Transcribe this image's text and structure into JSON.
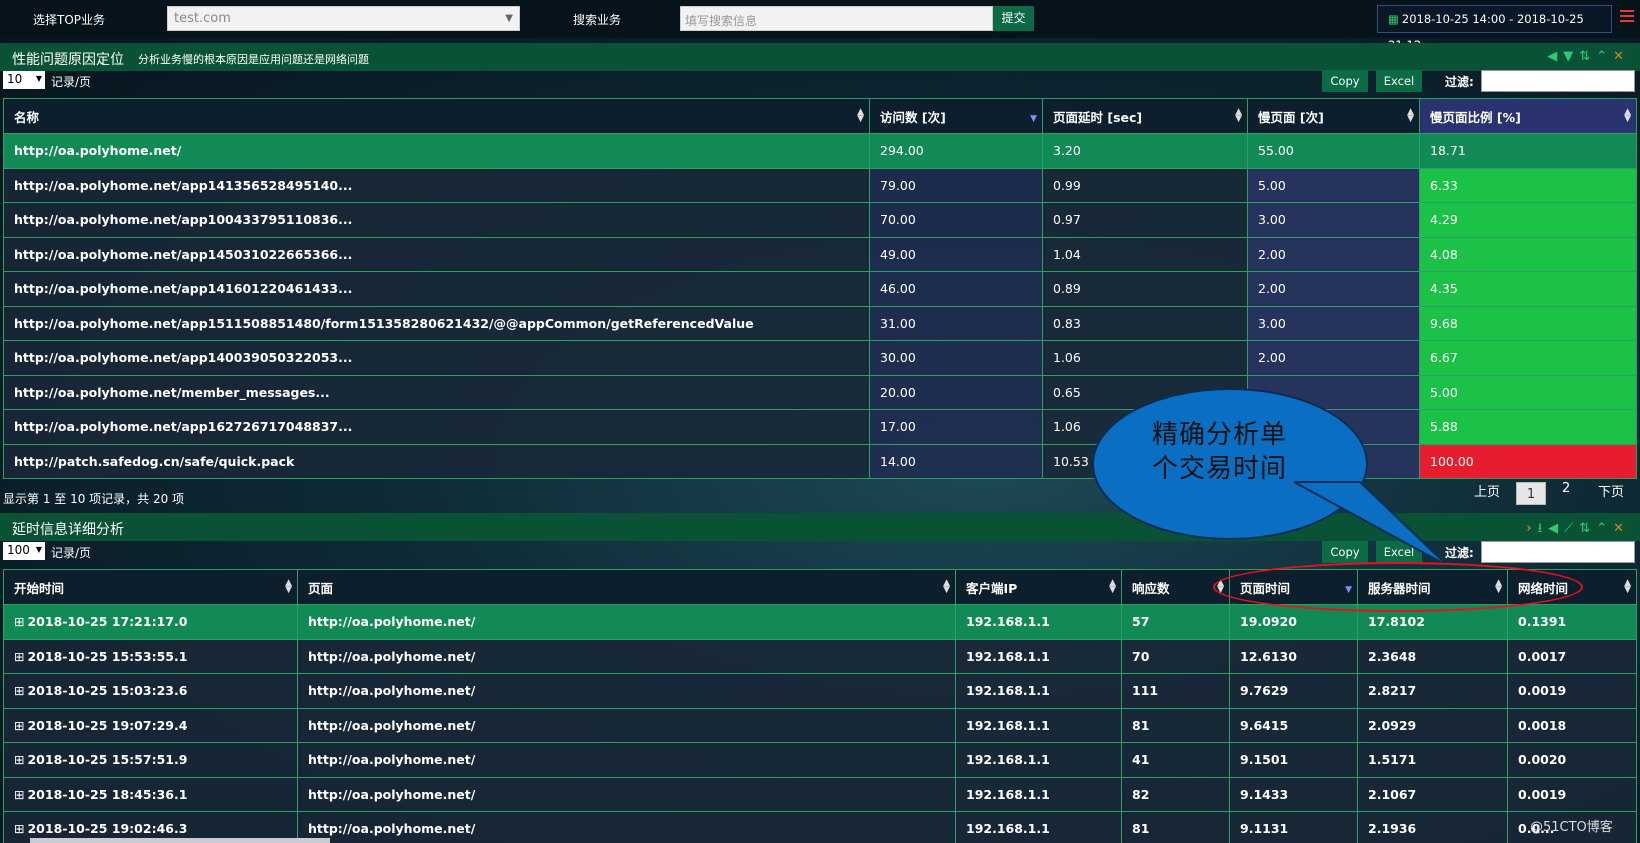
{
  "topbar": {
    "select_label": "选择TOP业务",
    "select_value": "test.com",
    "search_label": "搜索业务",
    "search_placeholder": "填写搜索信息",
    "submit_label": "提交",
    "date_range": "2018-10-25 14:00 - 2018-10-25 21:12"
  },
  "panel1": {
    "title": "性能问题原因定位",
    "subtitle": "分析业务慢的根本原因是应用问题还是网络问题",
    "page_size": "10",
    "page_size_label": "记录/页",
    "copy_label": "Copy",
    "excel_label": "Excel",
    "filter_label": "过滤:",
    "columns": [
      "名称",
      "访问数 [次]",
      "页面延时 [sec]",
      "慢页面 [次]",
      "慢页面比例 [%]"
    ],
    "rows": [
      {
        "name": "http://oa.polyhome.net/",
        "visits": "294.00",
        "delay": "3.20",
        "slow": "55.00",
        "ratio": "18.71",
        "ratio_color": "orange"
      },
      {
        "name": "http://oa.polyhome.net/app141356528495140...",
        "visits": "79.00",
        "delay": "0.99",
        "slow": "5.00",
        "ratio": "6.33",
        "ratio_color": "green"
      },
      {
        "name": "http://oa.polyhome.net/app100433795110836...",
        "visits": "70.00",
        "delay": "0.97",
        "slow": "3.00",
        "ratio": "4.29",
        "ratio_color": "green"
      },
      {
        "name": "http://oa.polyhome.net/app145031022665366...",
        "visits": "49.00",
        "delay": "1.04",
        "slow": "2.00",
        "ratio": "4.08",
        "ratio_color": "green"
      },
      {
        "name": "http://oa.polyhome.net/app141601220461433...",
        "visits": "46.00",
        "delay": "0.89",
        "slow": "2.00",
        "ratio": "4.35",
        "ratio_color": "green"
      },
      {
        "name": "http://oa.polyhome.net/app1511508851480/form151358280621432/@@appCommon/getReferencedValue",
        "visits": "31.00",
        "delay": "0.83",
        "slow": "3.00",
        "ratio": "9.68",
        "ratio_color": "green"
      },
      {
        "name": "http://oa.polyhome.net/app140039050322053...",
        "visits": "30.00",
        "delay": "1.06",
        "slow": "2.00",
        "ratio": "6.67",
        "ratio_color": "green"
      },
      {
        "name": "http://oa.polyhome.net/member_messages...",
        "visits": "20.00",
        "delay": "0.65",
        "slow": "",
        "ratio": "5.00",
        "ratio_color": "green"
      },
      {
        "name": "http://oa.polyhome.net/app162726717048837...",
        "visits": "17.00",
        "delay": "1.06",
        "slow": "",
        "ratio": "5.88",
        "ratio_color": "green"
      },
      {
        "name": "http://patch.safedog.cn/safe/quick.pack",
        "visits": "14.00",
        "delay": "10.53",
        "slow": "",
        "ratio": "100.00",
        "ratio_color": "red"
      }
    ],
    "info": "显示第 1 至 10 项记录，共 20 项",
    "prev": "上页",
    "page1": "1",
    "page2": "2",
    "next": "下页"
  },
  "panel2": {
    "title": "延时信息详细分析",
    "page_size": "100",
    "page_size_label": "记录/页",
    "copy_label": "Copy",
    "excel_label": "Excel",
    "filter_label": "过滤:",
    "columns": [
      "开始时间",
      "页面",
      "客户端IP",
      "响应数",
      "页面时间",
      "服务器时间",
      "网络时间"
    ],
    "rows": [
      {
        "time": "2018-10-25 17:21:17.0",
        "page": "http://oa.polyhome.net/",
        "ip": "192.168.1.1",
        "resp": "57",
        "pt": "19.0920",
        "st": "17.8102",
        "nt": "0.1391"
      },
      {
        "time": "2018-10-25 15:53:55.1",
        "page": "http://oa.polyhome.net/",
        "ip": "192.168.1.1",
        "resp": "70",
        "pt": "12.6130",
        "st": "2.3648",
        "nt": "0.0017"
      },
      {
        "time": "2018-10-25 15:03:23.6",
        "page": "http://oa.polyhome.net/",
        "ip": "192.168.1.1",
        "resp": "111",
        "pt": "9.7629",
        "st": "2.8217",
        "nt": "0.0019"
      },
      {
        "time": "2018-10-25 19:07:29.4",
        "page": "http://oa.polyhome.net/",
        "ip": "192.168.1.1",
        "resp": "81",
        "pt": "9.6415",
        "st": "2.0929",
        "nt": "0.0018"
      },
      {
        "time": "2018-10-25 15:57:51.9",
        "page": "http://oa.polyhome.net/",
        "ip": "192.168.1.1",
        "resp": "41",
        "pt": "9.1501",
        "st": "1.5171",
        "nt": "0.0020"
      },
      {
        "time": "2018-10-25 18:45:36.1",
        "page": "http://oa.polyhome.net/",
        "ip": "192.168.1.1",
        "resp": "82",
        "pt": "9.1433",
        "st": "2.1067",
        "nt": "0.0019"
      },
      {
        "time": "2018-10-25 19:02:46.3",
        "page": "http://oa.polyhome.net/",
        "ip": "192.168.1.1",
        "resp": "81",
        "pt": "9.1131",
        "st": "2.1936",
        "nt": "0.0..."
      }
    ]
  },
  "annotation": {
    "bubble_line1": "精确分析单",
    "bubble_line2": "个交易时间"
  },
  "watermark": "@51CTO博客",
  "colors": {
    "green": "#1cc248",
    "orange": "#f29a0e",
    "red": "#e51d2e",
    "accent": "#0c6b47"
  },
  "icons": [
    "calendar-icon",
    "menu-icon",
    "back-icon",
    "filter-icon",
    "sort-icon",
    "collapse-icon",
    "close-icon",
    "export-icon",
    "download-icon",
    "chart-icon"
  ]
}
